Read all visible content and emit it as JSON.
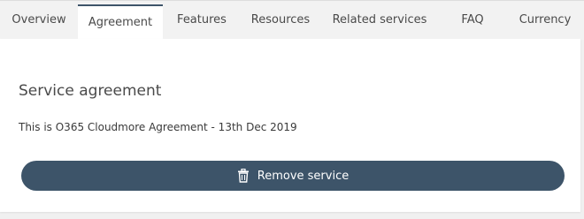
{
  "tabs": [
    {
      "label": "Overview"
    },
    {
      "label": "Agreement"
    },
    {
      "label": "Features"
    },
    {
      "label": "Resources"
    },
    {
      "label": "Related services"
    },
    {
      "label": "FAQ"
    },
    {
      "label": "Currency"
    }
  ],
  "active_tab": "Agreement",
  "agreement": {
    "heading": "Service agreement",
    "text": "This is O365 Cloudmore Agreement - 13th Dec 2019"
  },
  "actions": {
    "remove_label": "Remove service",
    "remove_icon": "trash-icon"
  },
  "colors": {
    "accent": "#3d5469",
    "tabbar_bg": "#f2f2f2",
    "panel_bg": "#ffffff"
  }
}
